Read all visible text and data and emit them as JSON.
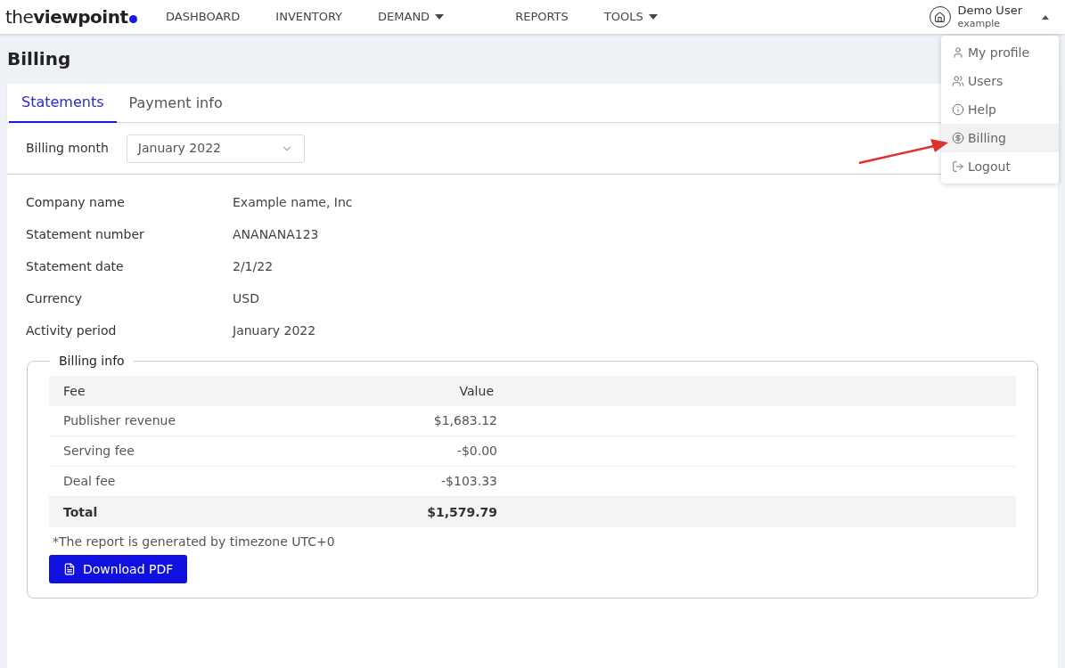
{
  "header": {
    "logo": {
      "light": "the",
      "bold": "viewpoint"
    },
    "nav": [
      {
        "label": "DASHBOARD",
        "kind": "link"
      },
      {
        "label": "INVENTORY",
        "kind": "link"
      },
      {
        "label": "DEMAND",
        "kind": "dropdown"
      },
      {
        "label": "REPORTS",
        "kind": "link"
      },
      {
        "label": "TOOLS",
        "kind": "dropdown"
      }
    ],
    "user": {
      "name": "Demo User",
      "account": "example",
      "expanded": true
    }
  },
  "user_menu": [
    {
      "label": "My profile",
      "kind": "profile",
      "selected": false
    },
    {
      "label": "Users",
      "kind": "users",
      "selected": false
    },
    {
      "label": "Help",
      "kind": "help",
      "selected": false
    },
    {
      "label": "Billing",
      "kind": "billing",
      "selected": true
    },
    {
      "label": "Logout",
      "kind": "logout",
      "selected": false
    }
  ],
  "page_title": "Billing",
  "tabs": [
    {
      "label": "Statements",
      "selected": true
    },
    {
      "label": "Payment info",
      "selected": false
    }
  ],
  "billing_month": {
    "label": "Billing month",
    "value": "January 2022"
  },
  "details": [
    {
      "label": "Company name",
      "value": "Example name, Inc"
    },
    {
      "label": "Statement number",
      "value": "ANANANA123"
    },
    {
      "label": "Statement date",
      "value": "2/1/22"
    },
    {
      "label": "Currency",
      "value": "USD"
    },
    {
      "label": "Activity period",
      "value": "January 2022"
    }
  ],
  "billing_info": {
    "title": "Billing info",
    "columns": [
      "Fee",
      "Value"
    ],
    "rows": [
      {
        "kind": "item",
        "fee": "Publisher revenue",
        "value": "$1,683.12"
      },
      {
        "kind": "item",
        "fee": "Serving fee",
        "value": "-$0.00"
      },
      {
        "kind": "item",
        "fee": "Deal fee",
        "value": "-$103.33"
      },
      {
        "kind": "total",
        "fee": "Total",
        "value": "$1,579.79"
      }
    ],
    "note": "*The report is generated by timezone UTC+0",
    "download_button": "Download PDF"
  }
}
